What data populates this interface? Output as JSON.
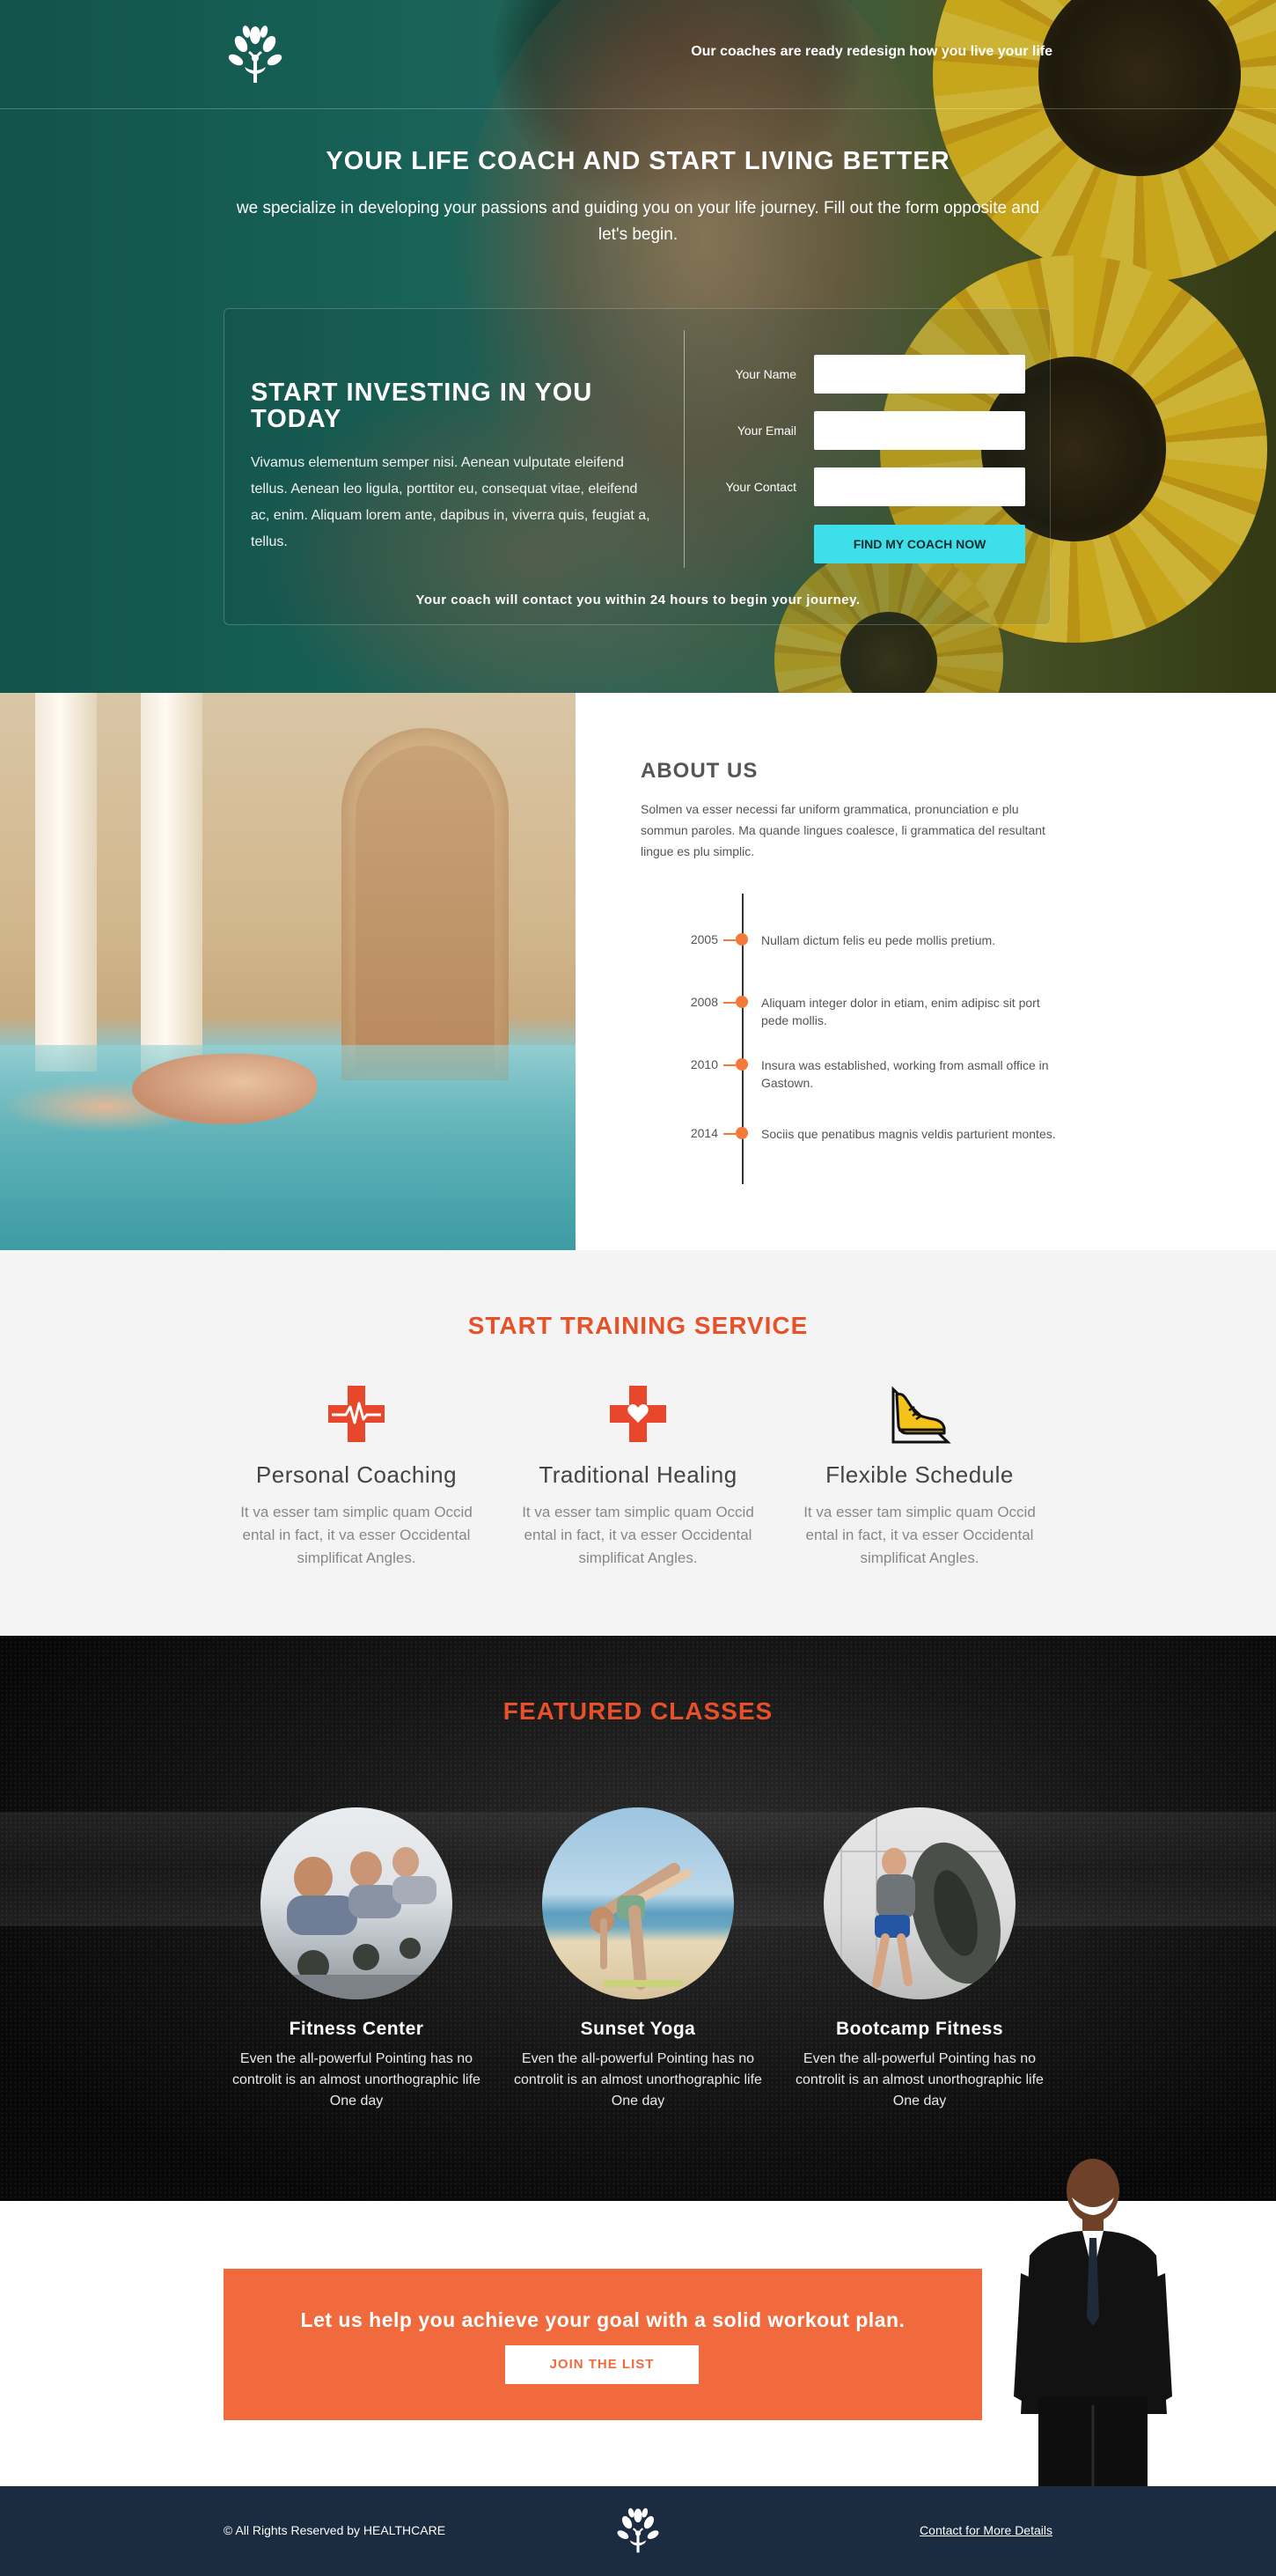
{
  "header": {
    "tagline": "Our coaches are ready redesign how you live your life"
  },
  "hero": {
    "title": "YOUR LIFE COACH AND START LIVING BETTER",
    "subtitle": "we specialize in developing your passions and guiding you on your life journey. Fill out the form opposite and let's begin.",
    "form": {
      "heading": "START INVESTING IN YOU TODAY",
      "body": "Vivamus elementum semper nisi. Aenean vulputate eleifend tellus. Aenean leo ligula, porttitor eu, consequat vitae, eleifend ac, enim. Aliquam lorem ante, dapibus in, viverra quis, feugiat a, tellus.",
      "name_label": "Your Name",
      "email_label": "Your Email",
      "contact_label": "Your Contact",
      "name_value": "",
      "email_value": "",
      "contact_value": "",
      "submit_label": "FIND MY COACH NOW",
      "note": "Your coach will contact you within 24 hours to begin your journey."
    }
  },
  "about": {
    "title": "ABOUT US",
    "text": "Solmen va esser necessi far uniform grammatica, pronunciation e plu sommun paroles. Ma quande lingues coalesce, li grammatica del resultant lingue es plu simplic.",
    "timeline": [
      {
        "year": "2005",
        "text": "Nullam dictum felis eu pede mollis pretium."
      },
      {
        "year": "2008",
        "text": "Aliquam integer dolor in etiam, enim adipisc sit port pede mollis."
      },
      {
        "year": "2010",
        "text": "Insura was established, working from asmall office in Gastown."
      },
      {
        "year": "2014",
        "text": "Sociis que penatibus magnis veldis parturient montes."
      }
    ]
  },
  "services": {
    "title": "START TRAINING SERVICE",
    "items": [
      {
        "name": "Personal Coaching",
        "text": "It va esser tam simplic quam Occid ental in fact, it va esser Occidental simplificat Angles.",
        "icon": "medical-cross-pulse-icon"
      },
      {
        "name": "Traditional Healing",
        "text": "It va esser tam simplic quam Occid ental in fact, it va esser Occidental simplificat Angles.",
        "icon": "medical-cross-heart-icon"
      },
      {
        "name": "Flexible Schedule",
        "text": "It va esser tam simplic quam Occid ental in fact, it va esser Occidental simplificat Angles.",
        "icon": "running-shoe-icon"
      }
    ]
  },
  "featured": {
    "title": "FEATURED CLASSES",
    "classes": [
      {
        "name": "Fitness Center",
        "text": "Even the all-powerful Pointing has no controlit is an almost unorthographic life One day"
      },
      {
        "name": "Sunset Yoga",
        "text": "Even the all-powerful Pointing has no controlit is an almost unorthographic life One day"
      },
      {
        "name": "Bootcamp Fitness",
        "text": "Even the all-powerful Pointing has no controlit is an almost unorthographic life One day"
      }
    ]
  },
  "cta": {
    "text": "Let us help you achieve your goal with a solid workout plan.",
    "button_label": "JOIN THE LIST"
  },
  "footer": {
    "copyright": "© All Rights Reserved by HEALTHCARE",
    "contact_link": "Contact for More Details"
  },
  "colors": {
    "accent_orange": "#f06a3d",
    "title_red": "#e8502a",
    "cyan_button": "#3de0ea",
    "footer_navy": "#1b2b40",
    "hero_teal": "#135e54"
  }
}
